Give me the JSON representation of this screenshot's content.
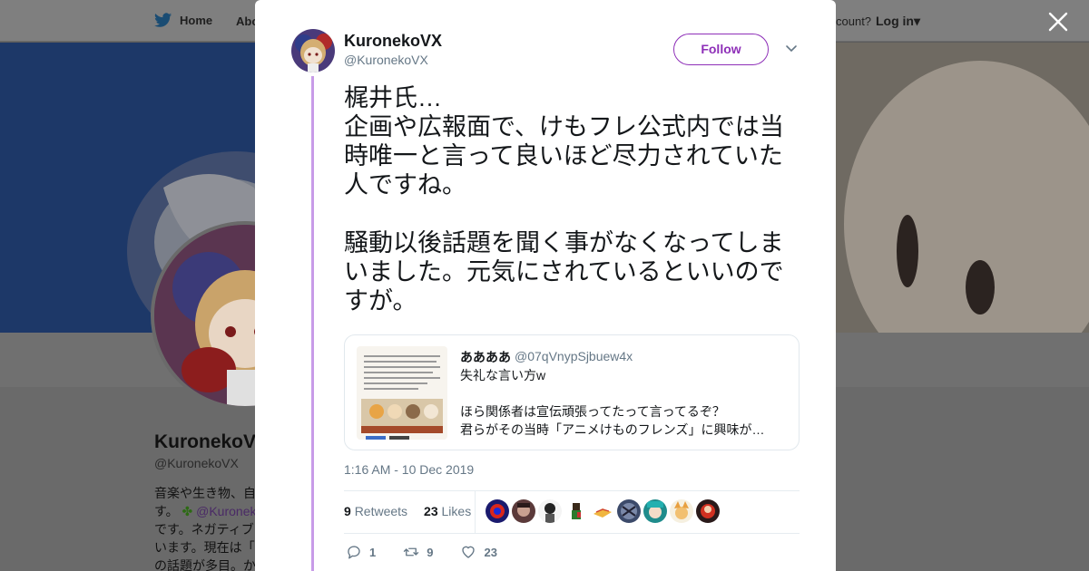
{
  "background": {
    "nav": {
      "home": "Home",
      "about": "Abo",
      "account_prompt": "count?",
      "login": "Log in"
    },
    "profile": {
      "name": "KuronekoV",
      "handle": "@KuronekoVX",
      "bio_lines": [
        "音楽や生き物、自",
        "す。",
        "@Kuronek",
        "です。ネガティブ",
        "います。現在は「",
        "の話題が多目。か"
      ]
    }
  },
  "tweet": {
    "author_name": "KuronekoVX",
    "author_handle": "@KuronekoVX",
    "follow_label": "Follow",
    "text_lines": [
      "梶井氏…",
      "企画や広報面で、けもフレ公式内では当時唯一と言って良いほど尽力されていた人ですね。",
      "",
      "騒動以後話題を聞く事がなくなってしまいました。元気にされているといいのですが。"
    ],
    "quote": {
      "name": "ああああ",
      "handle": "@07qVnypSjbuew4x",
      "lines": [
        "失礼な言い方w",
        "",
        "ほら関係者は宣伝頑張ってたって言ってるぞ？",
        "君らがその当時「アニメけものフレンズ」に興味が…"
      ]
    },
    "timestamp": "1:16 AM - 10 Dec 2019",
    "retweets_count": "9",
    "retweets_label": "Retweets",
    "likes_count": "23",
    "likes_label": "Likes",
    "actions": {
      "replies": "1",
      "retweets": "9",
      "likes": "23"
    },
    "likers": [
      "avatar-1",
      "avatar-2",
      "avatar-3",
      "avatar-4",
      "avatar-5",
      "avatar-6",
      "avatar-7",
      "avatar-8",
      "avatar-9"
    ]
  },
  "colors": {
    "accent": "#8e2fb8",
    "thread_line": "#c89be8",
    "muted": "#657786"
  }
}
